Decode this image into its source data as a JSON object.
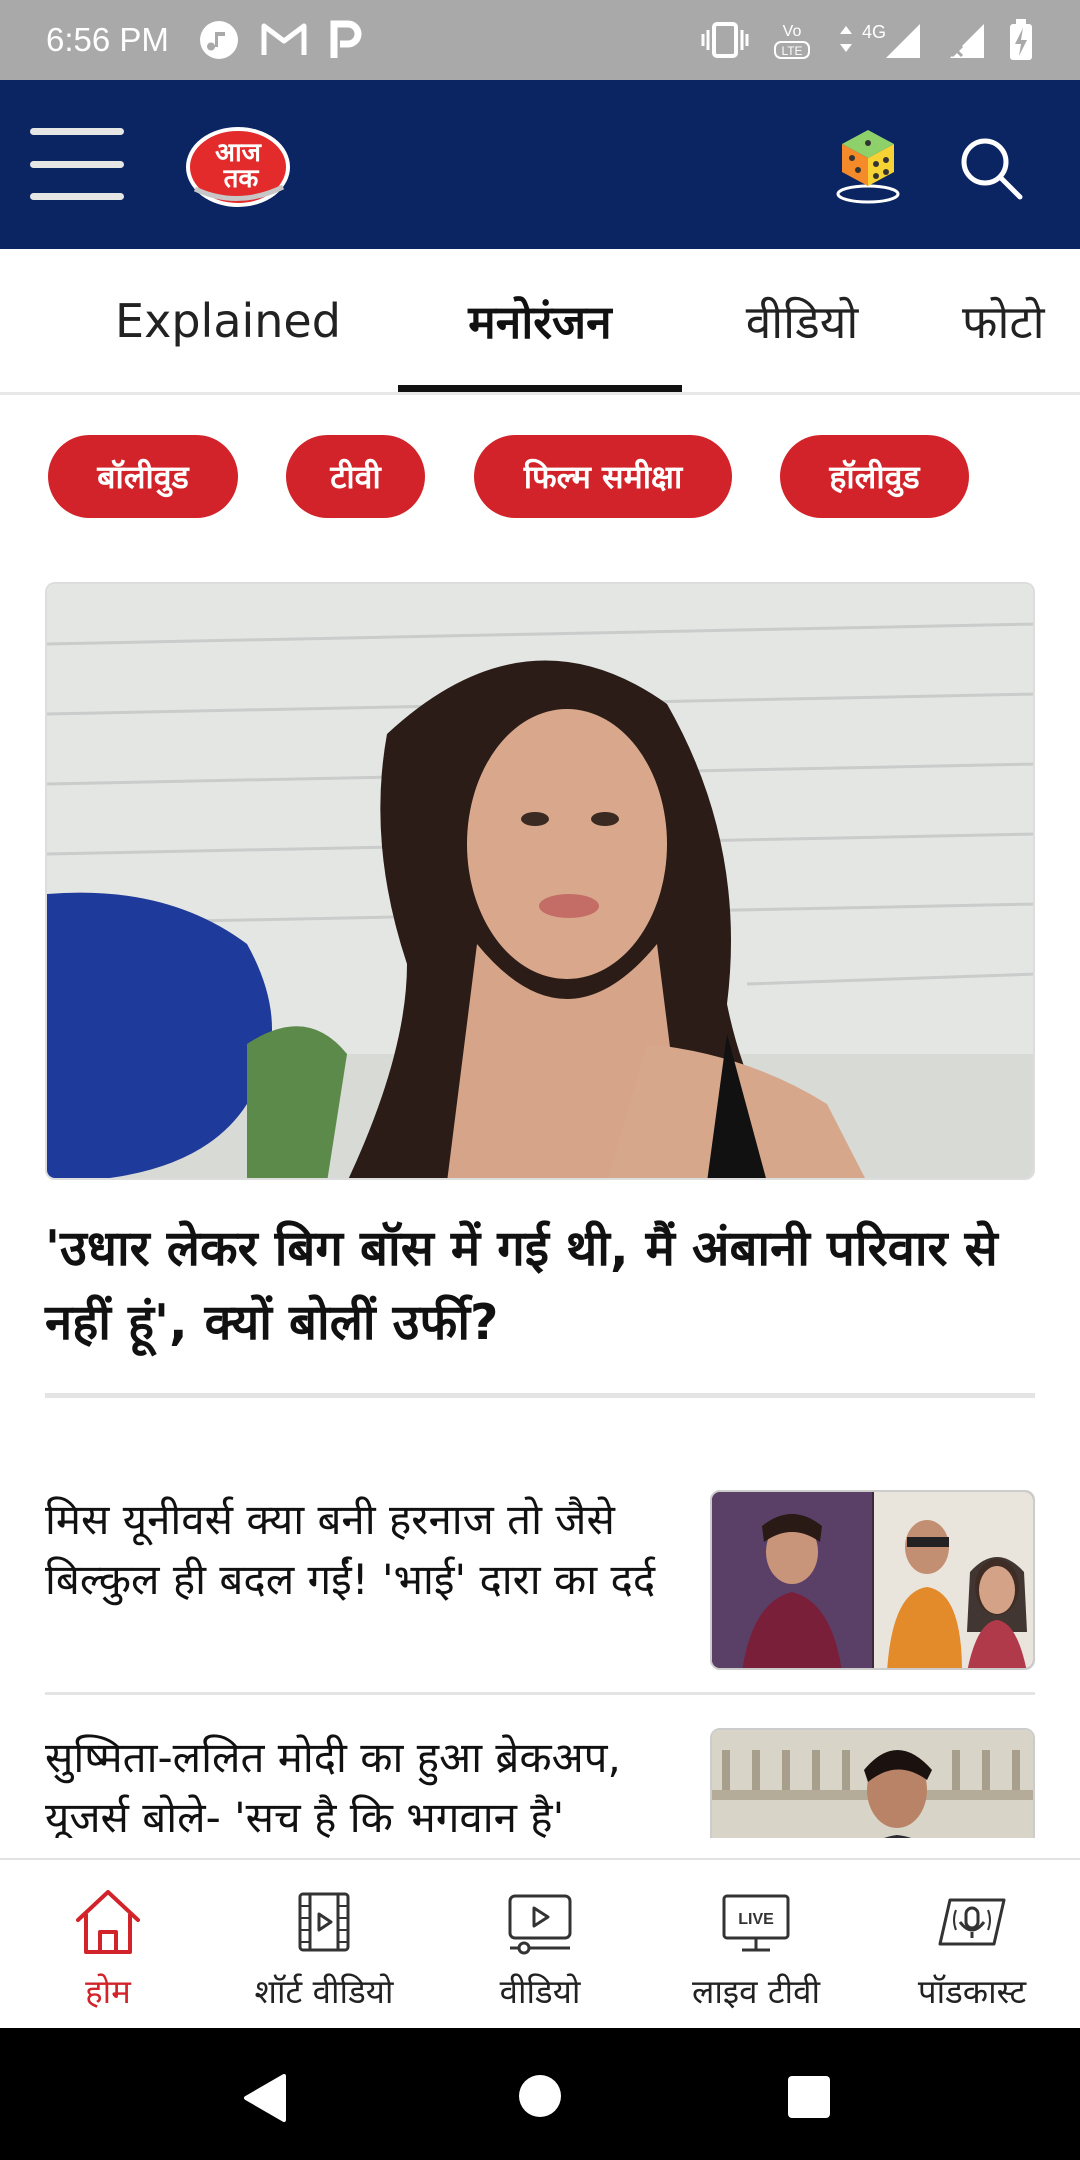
{
  "status_bar": {
    "time": "6:56 PM",
    "network": "4G"
  },
  "header": {
    "logo_text": "आज तक"
  },
  "tabs": [
    {
      "label": "Explained",
      "active": false
    },
    {
      "label": "मनोरंजन",
      "active": true
    },
    {
      "label": "वीडियो",
      "active": false
    },
    {
      "label": "फोटो",
      "active": false
    }
  ],
  "chips": [
    {
      "label": "बॉलीवुड"
    },
    {
      "label": "टीवी"
    },
    {
      "label": "फिल्म समीक्षा"
    },
    {
      "label": "हॉलीवुड"
    }
  ],
  "hero": {
    "title": "'उधार लेकर बिग बॉस में गई थी, मैं अंबानी परिवार से नहीं हूं', क्यों बोलीं उर्फी?"
  },
  "stories": [
    {
      "title": "मिस यूनीवर्स क्या बनी हरनाज तो जैसे बिल्कुल ही बदल गईं! 'भाई' दारा का दर्द"
    },
    {
      "title": "सुष्मिता-ललित मोदी का हुआ ब्रेकअप, यूजर्स बोले- 'सच है कि भगवान है'"
    }
  ],
  "bottom_nav": [
    {
      "label": "होम",
      "icon": "home-icon",
      "active": true
    },
    {
      "label": "शॉर्ट वीडियो",
      "icon": "short-video-icon",
      "active": false
    },
    {
      "label": "वीडियो",
      "icon": "video-icon",
      "active": false
    },
    {
      "label": "लाइव टीवी",
      "icon": "live-tv-icon",
      "active": false
    },
    {
      "label": "पॉडकास्ट",
      "icon": "podcast-icon",
      "active": false
    }
  ],
  "live_badge": "LIVE",
  "colors": {
    "header_bg": "#0b2563",
    "accent_red": "#d2232a",
    "status_bar_bg": "#a9a9a9"
  }
}
